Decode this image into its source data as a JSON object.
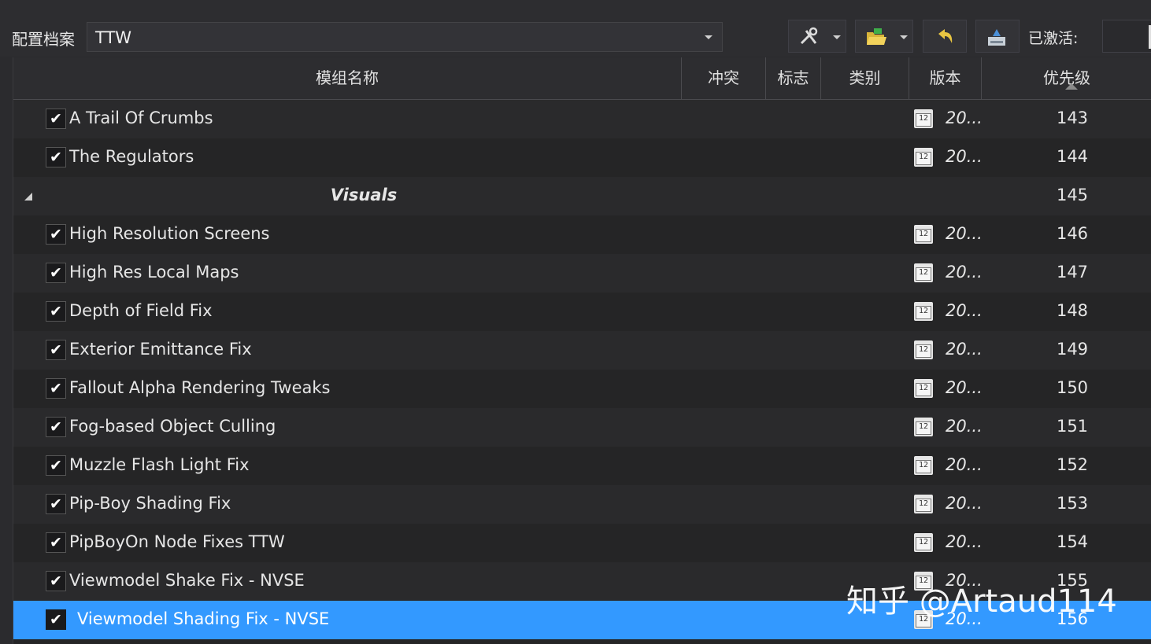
{
  "toolbar": {
    "profile_label": "配置档案",
    "profile_value": "TTW",
    "active_label": "已激活:"
  },
  "columns": {
    "name": "模组名称",
    "conflicts": "冲突",
    "flags": "标志",
    "category": "类别",
    "version": "版本",
    "priority": "优先级"
  },
  "rows": [
    {
      "name": "A Trail Of Crumbs",
      "version": "20...",
      "priority": "143",
      "checked": true
    },
    {
      "name": "The Regulators",
      "version": "20...",
      "priority": "144",
      "checked": true
    },
    {
      "name": "Visuals",
      "version": "",
      "priority": "145",
      "separator": true
    },
    {
      "name": "High Resolution Screens",
      "version": "20...",
      "priority": "146",
      "checked": true
    },
    {
      "name": "High Res Local Maps",
      "version": "20...",
      "priority": "147",
      "checked": true
    },
    {
      "name": "Depth of Field Fix",
      "version": "20...",
      "priority": "148",
      "checked": true
    },
    {
      "name": "Exterior Emittance Fix",
      "version": "20...",
      "priority": "149",
      "checked": true
    },
    {
      "name": "Fallout Alpha Rendering Tweaks",
      "version": "20...",
      "priority": "150",
      "checked": true
    },
    {
      "name": "Fog-based Object Culling",
      "version": "20...",
      "priority": "151",
      "checked": true
    },
    {
      "name": "Muzzle Flash Light Fix",
      "version": "20...",
      "priority": "152",
      "checked": true
    },
    {
      "name": "Pip-Boy Shading Fix",
      "version": "20...",
      "priority": "153",
      "checked": true
    },
    {
      "name": "PipBoyOn Node Fixes TTW",
      "version": "20...",
      "priority": "154",
      "checked": true
    },
    {
      "name": "Viewmodel Shake Fix - NVSE",
      "version": "20...",
      "priority": "155",
      "checked": true
    },
    {
      "name": "Viewmodel Shading Fix - NVSE",
      "version": "20...",
      "priority": "156",
      "checked": true,
      "selected": true
    }
  ],
  "calendar_icon_text": "12",
  "checkmark": "✔",
  "watermark": "知乎 @Artaud114",
  "colors": {
    "selection": "#3399ff",
    "background": "#252526"
  }
}
